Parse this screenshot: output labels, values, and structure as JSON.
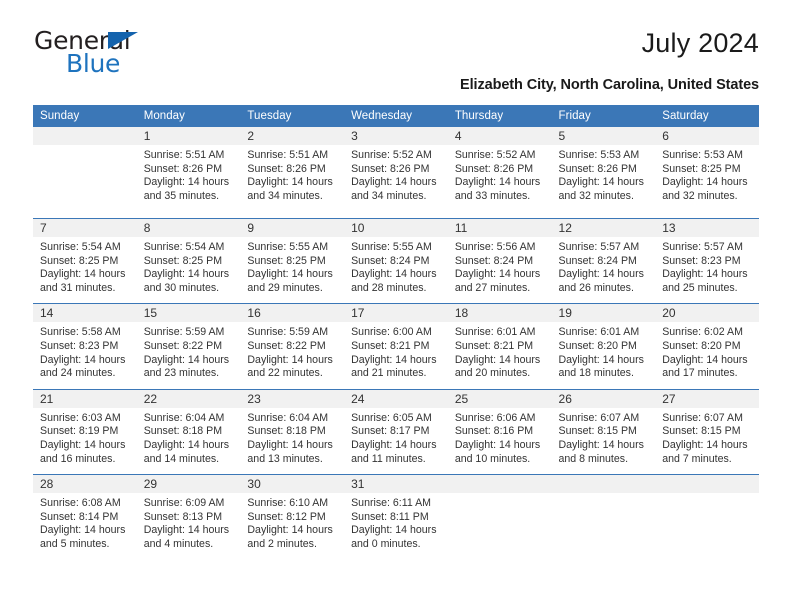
{
  "brand": {
    "name_part1": "General",
    "name_part2": "Blue",
    "triangle_color": "#1463ad",
    "blue_color": "#1e73be"
  },
  "header": {
    "title": "July 2024",
    "subtitle": "Elizabeth City, North Carolina, United States",
    "header_bg_color": "#3b77b7",
    "daynum_bg_color": "#f1f1f1"
  },
  "weekdays": [
    "Sunday",
    "Monday",
    "Tuesday",
    "Wednesday",
    "Thursday",
    "Friday",
    "Saturday"
  ],
  "weeks": [
    [
      {
        "day": "",
        "sunrise": "",
        "sunset": "",
        "daylight1": "",
        "daylight2": ""
      },
      {
        "day": "1",
        "sunrise": "Sunrise: 5:51 AM",
        "sunset": "Sunset: 8:26 PM",
        "daylight1": "Daylight: 14 hours",
        "daylight2": "and 35 minutes."
      },
      {
        "day": "2",
        "sunrise": "Sunrise: 5:51 AM",
        "sunset": "Sunset: 8:26 PM",
        "daylight1": "Daylight: 14 hours",
        "daylight2": "and 34 minutes."
      },
      {
        "day": "3",
        "sunrise": "Sunrise: 5:52 AM",
        "sunset": "Sunset: 8:26 PM",
        "daylight1": "Daylight: 14 hours",
        "daylight2": "and 34 minutes."
      },
      {
        "day": "4",
        "sunrise": "Sunrise: 5:52 AM",
        "sunset": "Sunset: 8:26 PM",
        "daylight1": "Daylight: 14 hours",
        "daylight2": "and 33 minutes."
      },
      {
        "day": "5",
        "sunrise": "Sunrise: 5:53 AM",
        "sunset": "Sunset: 8:26 PM",
        "daylight1": "Daylight: 14 hours",
        "daylight2": "and 32 minutes."
      },
      {
        "day": "6",
        "sunrise": "Sunrise: 5:53 AM",
        "sunset": "Sunset: 8:25 PM",
        "daylight1": "Daylight: 14 hours",
        "daylight2": "and 32 minutes."
      }
    ],
    [
      {
        "day": "7",
        "sunrise": "Sunrise: 5:54 AM",
        "sunset": "Sunset: 8:25 PM",
        "daylight1": "Daylight: 14 hours",
        "daylight2": "and 31 minutes."
      },
      {
        "day": "8",
        "sunrise": "Sunrise: 5:54 AM",
        "sunset": "Sunset: 8:25 PM",
        "daylight1": "Daylight: 14 hours",
        "daylight2": "and 30 minutes."
      },
      {
        "day": "9",
        "sunrise": "Sunrise: 5:55 AM",
        "sunset": "Sunset: 8:25 PM",
        "daylight1": "Daylight: 14 hours",
        "daylight2": "and 29 minutes."
      },
      {
        "day": "10",
        "sunrise": "Sunrise: 5:55 AM",
        "sunset": "Sunset: 8:24 PM",
        "daylight1": "Daylight: 14 hours",
        "daylight2": "and 28 minutes."
      },
      {
        "day": "11",
        "sunrise": "Sunrise: 5:56 AM",
        "sunset": "Sunset: 8:24 PM",
        "daylight1": "Daylight: 14 hours",
        "daylight2": "and 27 minutes."
      },
      {
        "day": "12",
        "sunrise": "Sunrise: 5:57 AM",
        "sunset": "Sunset: 8:24 PM",
        "daylight1": "Daylight: 14 hours",
        "daylight2": "and 26 minutes."
      },
      {
        "day": "13",
        "sunrise": "Sunrise: 5:57 AM",
        "sunset": "Sunset: 8:23 PM",
        "daylight1": "Daylight: 14 hours",
        "daylight2": "and 25 minutes."
      }
    ],
    [
      {
        "day": "14",
        "sunrise": "Sunrise: 5:58 AM",
        "sunset": "Sunset: 8:23 PM",
        "daylight1": "Daylight: 14 hours",
        "daylight2": "and 24 minutes."
      },
      {
        "day": "15",
        "sunrise": "Sunrise: 5:59 AM",
        "sunset": "Sunset: 8:22 PM",
        "daylight1": "Daylight: 14 hours",
        "daylight2": "and 23 minutes."
      },
      {
        "day": "16",
        "sunrise": "Sunrise: 5:59 AM",
        "sunset": "Sunset: 8:22 PM",
        "daylight1": "Daylight: 14 hours",
        "daylight2": "and 22 minutes."
      },
      {
        "day": "17",
        "sunrise": "Sunrise: 6:00 AM",
        "sunset": "Sunset: 8:21 PM",
        "daylight1": "Daylight: 14 hours",
        "daylight2": "and 21 minutes."
      },
      {
        "day": "18",
        "sunrise": "Sunrise: 6:01 AM",
        "sunset": "Sunset: 8:21 PM",
        "daylight1": "Daylight: 14 hours",
        "daylight2": "and 20 minutes."
      },
      {
        "day": "19",
        "sunrise": "Sunrise: 6:01 AM",
        "sunset": "Sunset: 8:20 PM",
        "daylight1": "Daylight: 14 hours",
        "daylight2": "and 18 minutes."
      },
      {
        "day": "20",
        "sunrise": "Sunrise: 6:02 AM",
        "sunset": "Sunset: 8:20 PM",
        "daylight1": "Daylight: 14 hours",
        "daylight2": "and 17 minutes."
      }
    ],
    [
      {
        "day": "21",
        "sunrise": "Sunrise: 6:03 AM",
        "sunset": "Sunset: 8:19 PM",
        "daylight1": "Daylight: 14 hours",
        "daylight2": "and 16 minutes."
      },
      {
        "day": "22",
        "sunrise": "Sunrise: 6:04 AM",
        "sunset": "Sunset: 8:18 PM",
        "daylight1": "Daylight: 14 hours",
        "daylight2": "and 14 minutes."
      },
      {
        "day": "23",
        "sunrise": "Sunrise: 6:04 AM",
        "sunset": "Sunset: 8:18 PM",
        "daylight1": "Daylight: 14 hours",
        "daylight2": "and 13 minutes."
      },
      {
        "day": "24",
        "sunrise": "Sunrise: 6:05 AM",
        "sunset": "Sunset: 8:17 PM",
        "daylight1": "Daylight: 14 hours",
        "daylight2": "and 11 minutes."
      },
      {
        "day": "25",
        "sunrise": "Sunrise: 6:06 AM",
        "sunset": "Sunset: 8:16 PM",
        "daylight1": "Daylight: 14 hours",
        "daylight2": "and 10 minutes."
      },
      {
        "day": "26",
        "sunrise": "Sunrise: 6:07 AM",
        "sunset": "Sunset: 8:15 PM",
        "daylight1": "Daylight: 14 hours",
        "daylight2": "and 8 minutes."
      },
      {
        "day": "27",
        "sunrise": "Sunrise: 6:07 AM",
        "sunset": "Sunset: 8:15 PM",
        "daylight1": "Daylight: 14 hours",
        "daylight2": "and 7 minutes."
      }
    ],
    [
      {
        "day": "28",
        "sunrise": "Sunrise: 6:08 AM",
        "sunset": "Sunset: 8:14 PM",
        "daylight1": "Daylight: 14 hours",
        "daylight2": "and 5 minutes."
      },
      {
        "day": "29",
        "sunrise": "Sunrise: 6:09 AM",
        "sunset": "Sunset: 8:13 PM",
        "daylight1": "Daylight: 14 hours",
        "daylight2": "and 4 minutes."
      },
      {
        "day": "30",
        "sunrise": "Sunrise: 6:10 AM",
        "sunset": "Sunset: 8:12 PM",
        "daylight1": "Daylight: 14 hours",
        "daylight2": "and 2 minutes."
      },
      {
        "day": "31",
        "sunrise": "Sunrise: 6:11 AM",
        "sunset": "Sunset: 8:11 PM",
        "daylight1": "Daylight: 14 hours",
        "daylight2": "and 0 minutes."
      },
      {
        "day": "",
        "sunrise": "",
        "sunset": "",
        "daylight1": "",
        "daylight2": ""
      },
      {
        "day": "",
        "sunrise": "",
        "sunset": "",
        "daylight1": "",
        "daylight2": ""
      },
      {
        "day": "",
        "sunrise": "",
        "sunset": "",
        "daylight1": "",
        "daylight2": ""
      }
    ]
  ]
}
